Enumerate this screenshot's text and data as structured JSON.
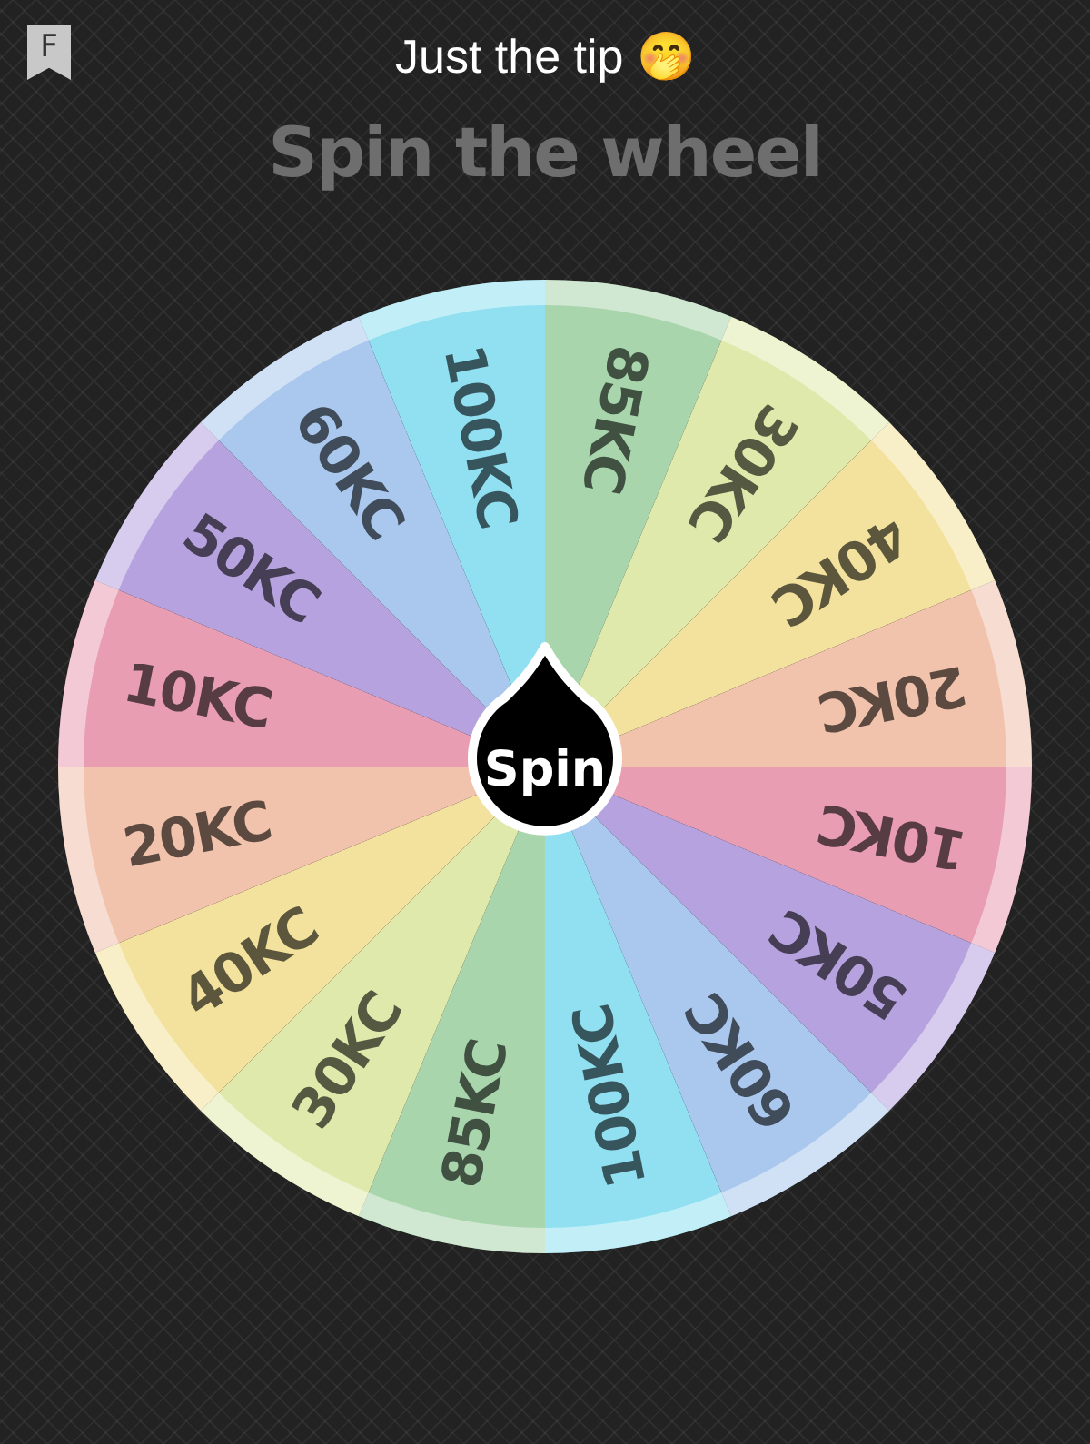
{
  "header": {
    "badge": "F",
    "title": "Just the tip 🤭"
  },
  "heading": "Spin the wheel",
  "wheel": {
    "button": "Spin",
    "segments": [
      {
        "label": "85KC",
        "color": "#a9d5ad"
      },
      {
        "label": "30KC",
        "color": "#e0e9ac"
      },
      {
        "label": "40KC",
        "color": "#f3e29d"
      },
      {
        "label": "20KC",
        "color": "#f1c2ac"
      },
      {
        "label": "10KC",
        "color": "#e89db2"
      },
      {
        "label": "50KC",
        "color": "#b6a2de"
      },
      {
        "label": "60KC",
        "color": "#aac8ee"
      },
      {
        "label": "100KC",
        "color": "#90e0f1"
      },
      {
        "label": "85KC",
        "color": "#a9d5ad"
      },
      {
        "label": "30KC",
        "color": "#e0e9ac"
      },
      {
        "label": "40KC",
        "color": "#f3e29d"
      },
      {
        "label": "20KC",
        "color": "#f1c2ac"
      },
      {
        "label": "10KC",
        "color": "#e89db2"
      },
      {
        "label": "50KC",
        "color": "#b6a2de"
      },
      {
        "label": "60KC",
        "color": "#aac8ee"
      },
      {
        "label": "100KC",
        "color": "#90e0f1"
      }
    ]
  }
}
